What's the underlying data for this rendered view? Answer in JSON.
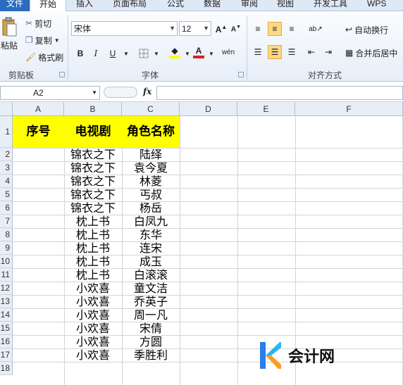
{
  "ribbon": {
    "tabs": [
      "文件",
      "开始",
      "插入",
      "页面布局",
      "公式",
      "数据",
      "审阅",
      "视图",
      "开发工具",
      "WPS PDF"
    ],
    "clipboard": {
      "paste": "粘贴",
      "cut": "剪切",
      "copy": "复制",
      "format_painter": "格式刷",
      "group": "剪贴板"
    },
    "font": {
      "name": "宋体",
      "size": "12",
      "group": "字体"
    },
    "alignment": {
      "wrap": "自动换行",
      "merge": "合并后居中",
      "group": "对齐方式"
    }
  },
  "formula_bar": {
    "name_box": "A2",
    "fx": "fx",
    "value": ""
  },
  "sheet": {
    "columns": [
      "A",
      "B",
      "C",
      "D",
      "E",
      "F"
    ],
    "row_numbers": [
      "1",
      "2",
      "3",
      "4",
      "5",
      "6",
      "7",
      "8",
      "9",
      "10",
      "11",
      "12",
      "13",
      "14",
      "15",
      "16",
      "17",
      "18"
    ],
    "header": [
      "序号",
      "电视剧",
      "角色名称"
    ],
    "rows": [
      [
        "",
        "锦衣之下",
        "陆绎"
      ],
      [
        "",
        "锦衣之下",
        "袁今夏"
      ],
      [
        "",
        "锦衣之下",
        "林菱"
      ],
      [
        "",
        "锦衣之下",
        "丐叔"
      ],
      [
        "",
        "锦衣之下",
        "杨岳"
      ],
      [
        "",
        "枕上书",
        "白凤九"
      ],
      [
        "",
        "枕上书",
        "东华"
      ],
      [
        "",
        "枕上书",
        "连宋"
      ],
      [
        "",
        "枕上书",
        "成玉"
      ],
      [
        "",
        "枕上书",
        "白滚滚"
      ],
      [
        "",
        "小欢喜",
        "童文洁"
      ],
      [
        "",
        "小欢喜",
        "乔英子"
      ],
      [
        "",
        "小欢喜",
        "周一凡"
      ],
      [
        "",
        "小欢喜",
        "宋倩"
      ],
      [
        "",
        "小欢喜",
        "方圆"
      ],
      [
        "",
        "小欢喜",
        "季胜利"
      ]
    ]
  },
  "watermark": {
    "text": "会计网"
  },
  "colors": {
    "header_fill": "#ffff00",
    "ribbon_blue": "#2a6cc0",
    "selected_button": "#fbd984"
  }
}
